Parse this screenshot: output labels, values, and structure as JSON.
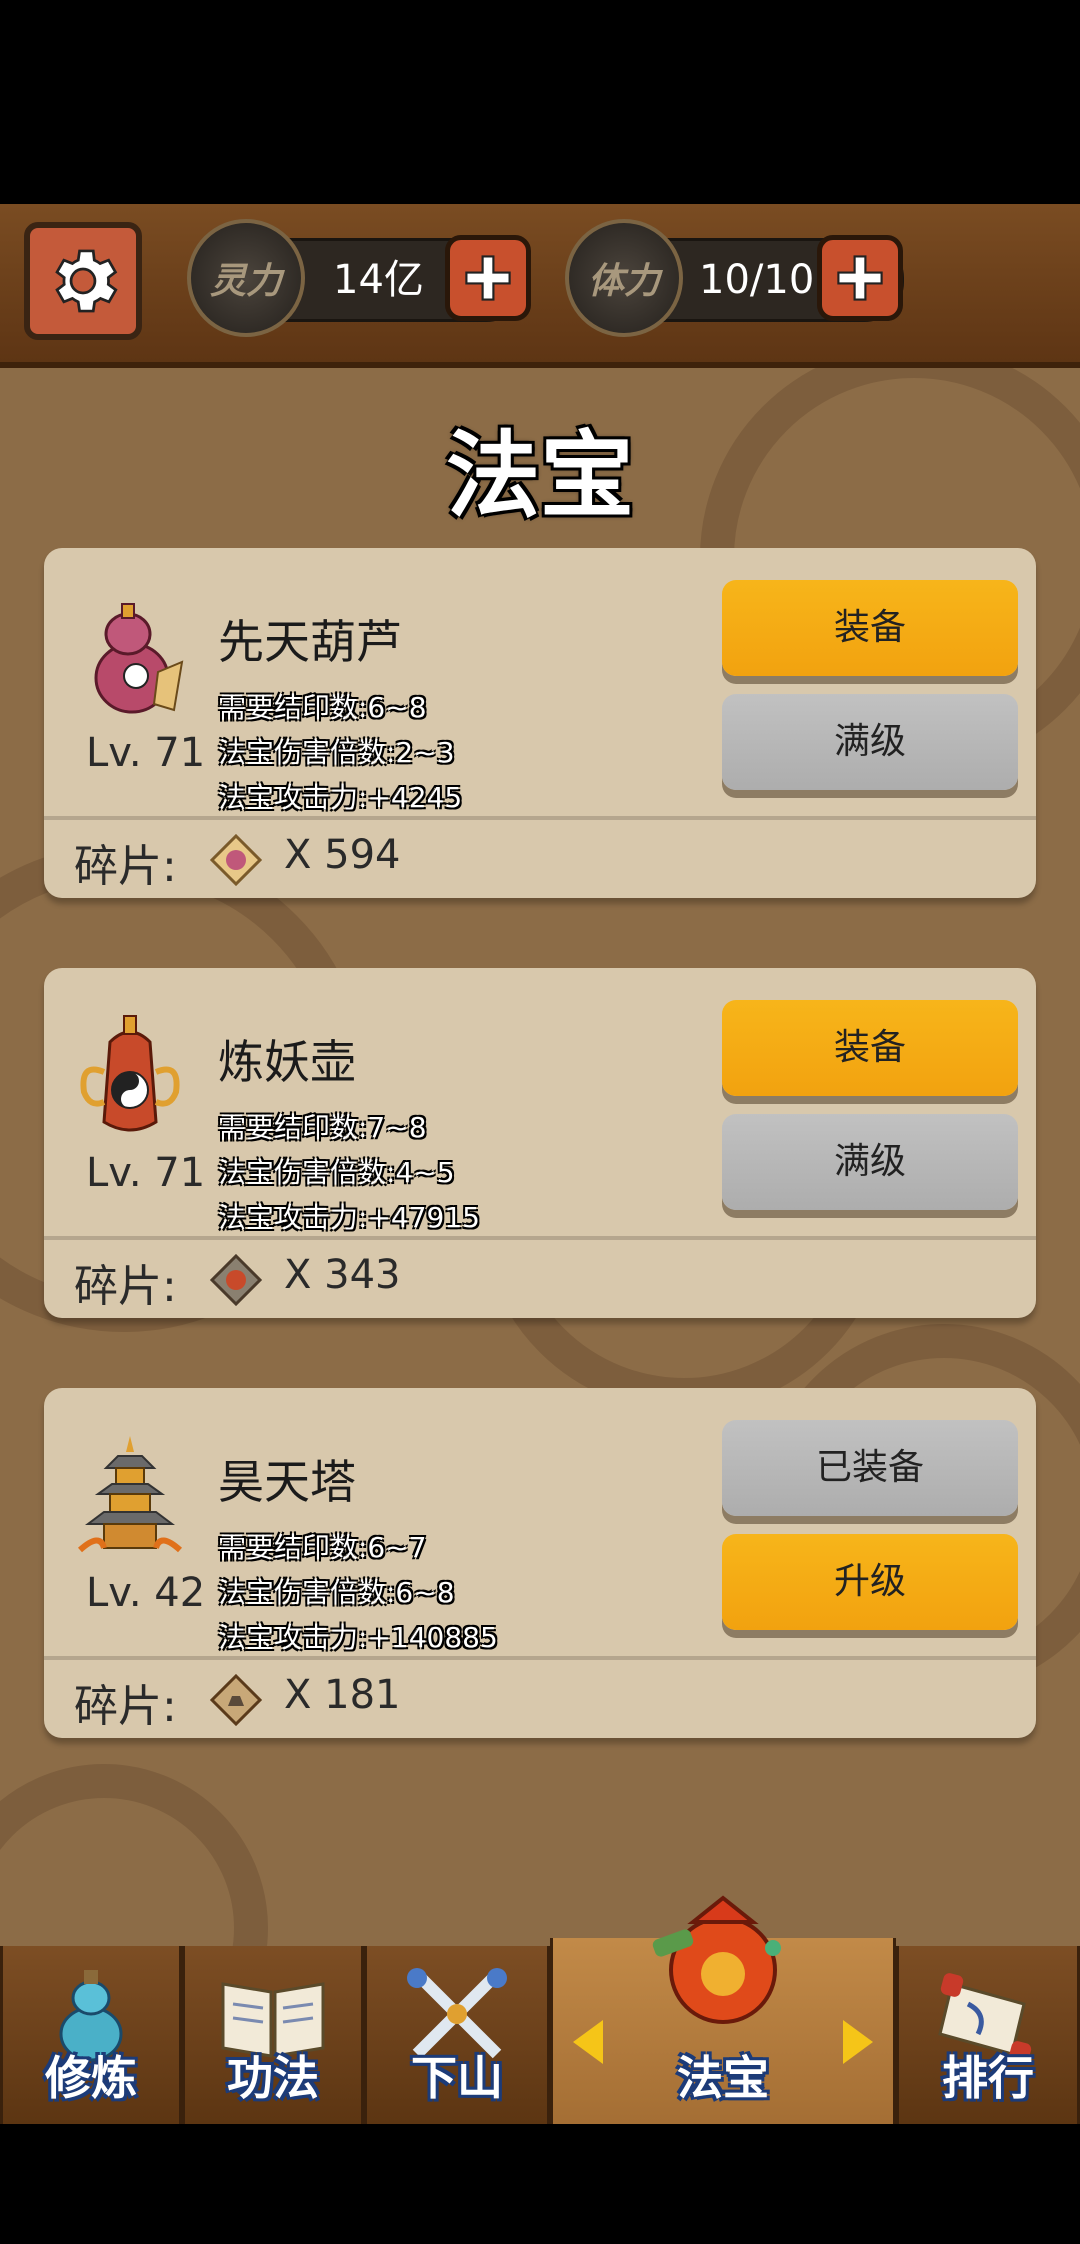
{
  "topbar": {
    "resources": [
      {
        "icon_text": "灵力",
        "value": "14亿"
      },
      {
        "icon_text": "体力",
        "value": "10/10"
      }
    ]
  },
  "page_title": "法宝",
  "fragment_label": "碎片:",
  "items": [
    {
      "name": "先天葫芦",
      "level": "Lv. 71",
      "stats": [
        "需要结印数:6~8",
        "法宝伤害倍数:2~3",
        "法宝攻击力:+4245"
      ],
      "buttons": [
        {
          "label": "装备",
          "style": "yellow"
        },
        {
          "label": "满级",
          "style": "gray"
        }
      ],
      "fragments": "X  594"
    },
    {
      "name": "炼妖壶",
      "level": "Lv. 71",
      "stats": [
        "需要结印数:7~8",
        "法宝伤害倍数:4~5",
        "法宝攻击力:+47915"
      ],
      "buttons": [
        {
          "label": "装备",
          "style": "yellow"
        },
        {
          "label": "满级",
          "style": "gray"
        }
      ],
      "fragments": "X  343"
    },
    {
      "name": "昊天塔",
      "level": "Lv. 42",
      "stats": [
        "需要结印数:6~7",
        "法宝伤害倍数:6~8",
        "法宝攻击力:+140885"
      ],
      "buttons": [
        {
          "label": "已装备",
          "style": "gray"
        },
        {
          "label": "升级",
          "style": "yellow"
        }
      ],
      "fragments": "X  181"
    }
  ],
  "nav": {
    "tabs": [
      {
        "label": "修炼",
        "icon": "gourd-icon"
      },
      {
        "label": "功法",
        "icon": "book-icon"
      },
      {
        "label": "下山",
        "icon": "crossed-swords-icon"
      },
      {
        "label": "法宝",
        "icon": "treasure-bag-icon",
        "active": true
      },
      {
        "label": "排行",
        "icon": "scroll-icon"
      }
    ]
  },
  "colors": {
    "accent_yellow": "#f7b51a",
    "button_gray": "#b8b8b8",
    "card": "#d8c8ac",
    "background": "#8c6c47"
  }
}
